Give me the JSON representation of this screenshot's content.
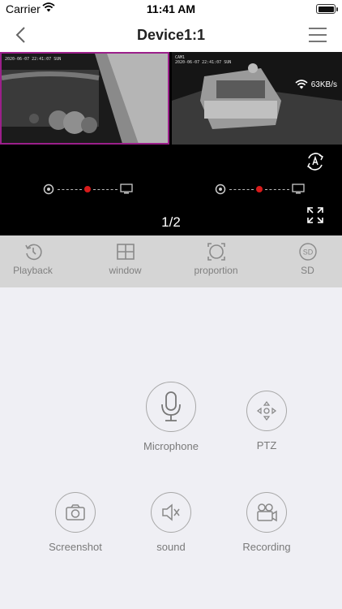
{
  "status": {
    "carrier": "Carrier",
    "time": "11:41 AM"
  },
  "nav": {
    "title": "Device1:1"
  },
  "video": {
    "cam1_timestamp": "2020-06-07 22:41:07 SUN",
    "cam2_label": "CAM1",
    "cam2_timestamp": "2020-06-07 22:41:07 SUN",
    "speed": "63KB/s",
    "page": "1/2"
  },
  "toolbar": [
    {
      "label": "Playback",
      "icon": "playback-icon"
    },
    {
      "label": "window",
      "icon": "window-grid-icon"
    },
    {
      "label": "proportion",
      "icon": "proportion-icon"
    },
    {
      "label": "SD",
      "icon": "sd-icon"
    }
  ],
  "controls": {
    "microphone": "Microphone",
    "ptz": "PTZ",
    "screenshot": "Screenshot",
    "sound": "sound",
    "recording": "Recording"
  }
}
